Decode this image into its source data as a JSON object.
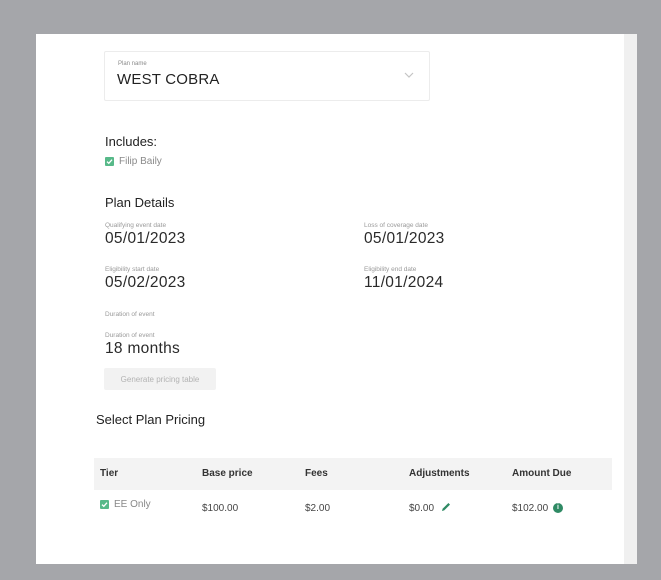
{
  "plan": {
    "name_label": "Plan name",
    "name_value": "WEST COBRA",
    "chevron_icon": "chevron-down-icon"
  },
  "includes": {
    "heading": "Includes:",
    "members": [
      {
        "name": "Filip Baily",
        "checked": true
      }
    ]
  },
  "details": {
    "heading": "Plan Details",
    "qualifying_label": "Qualifying event date",
    "qualifying_value": "05/01/2023",
    "loss_label": "Loss of coverage date",
    "loss_value": "05/01/2023",
    "elig_start_label": "Eligibility start date",
    "elig_start_value": "05/02/2023",
    "elig_end_label": "Eligibility end date",
    "elig_end_value": "11/01/2024",
    "duration_label_1": "Duration of event",
    "duration_label_2": "Duration of event",
    "duration_value": "18 months",
    "generate_button": "Generate pricing table"
  },
  "pricing": {
    "heading": "Select Plan Pricing",
    "columns": [
      "Tier",
      "Base price",
      "Fees",
      "Adjustments",
      "Amount Due"
    ],
    "rows": [
      {
        "tier": "EE Only",
        "checked": true,
        "base": "$100.00",
        "fees": "$2.00",
        "adjustments": "$0.00",
        "amount_due": "$102.00"
      }
    ]
  },
  "colors": {
    "accent": "#57b989",
    "info": "#2f8a64",
    "backdrop": "#a5a6aa"
  }
}
